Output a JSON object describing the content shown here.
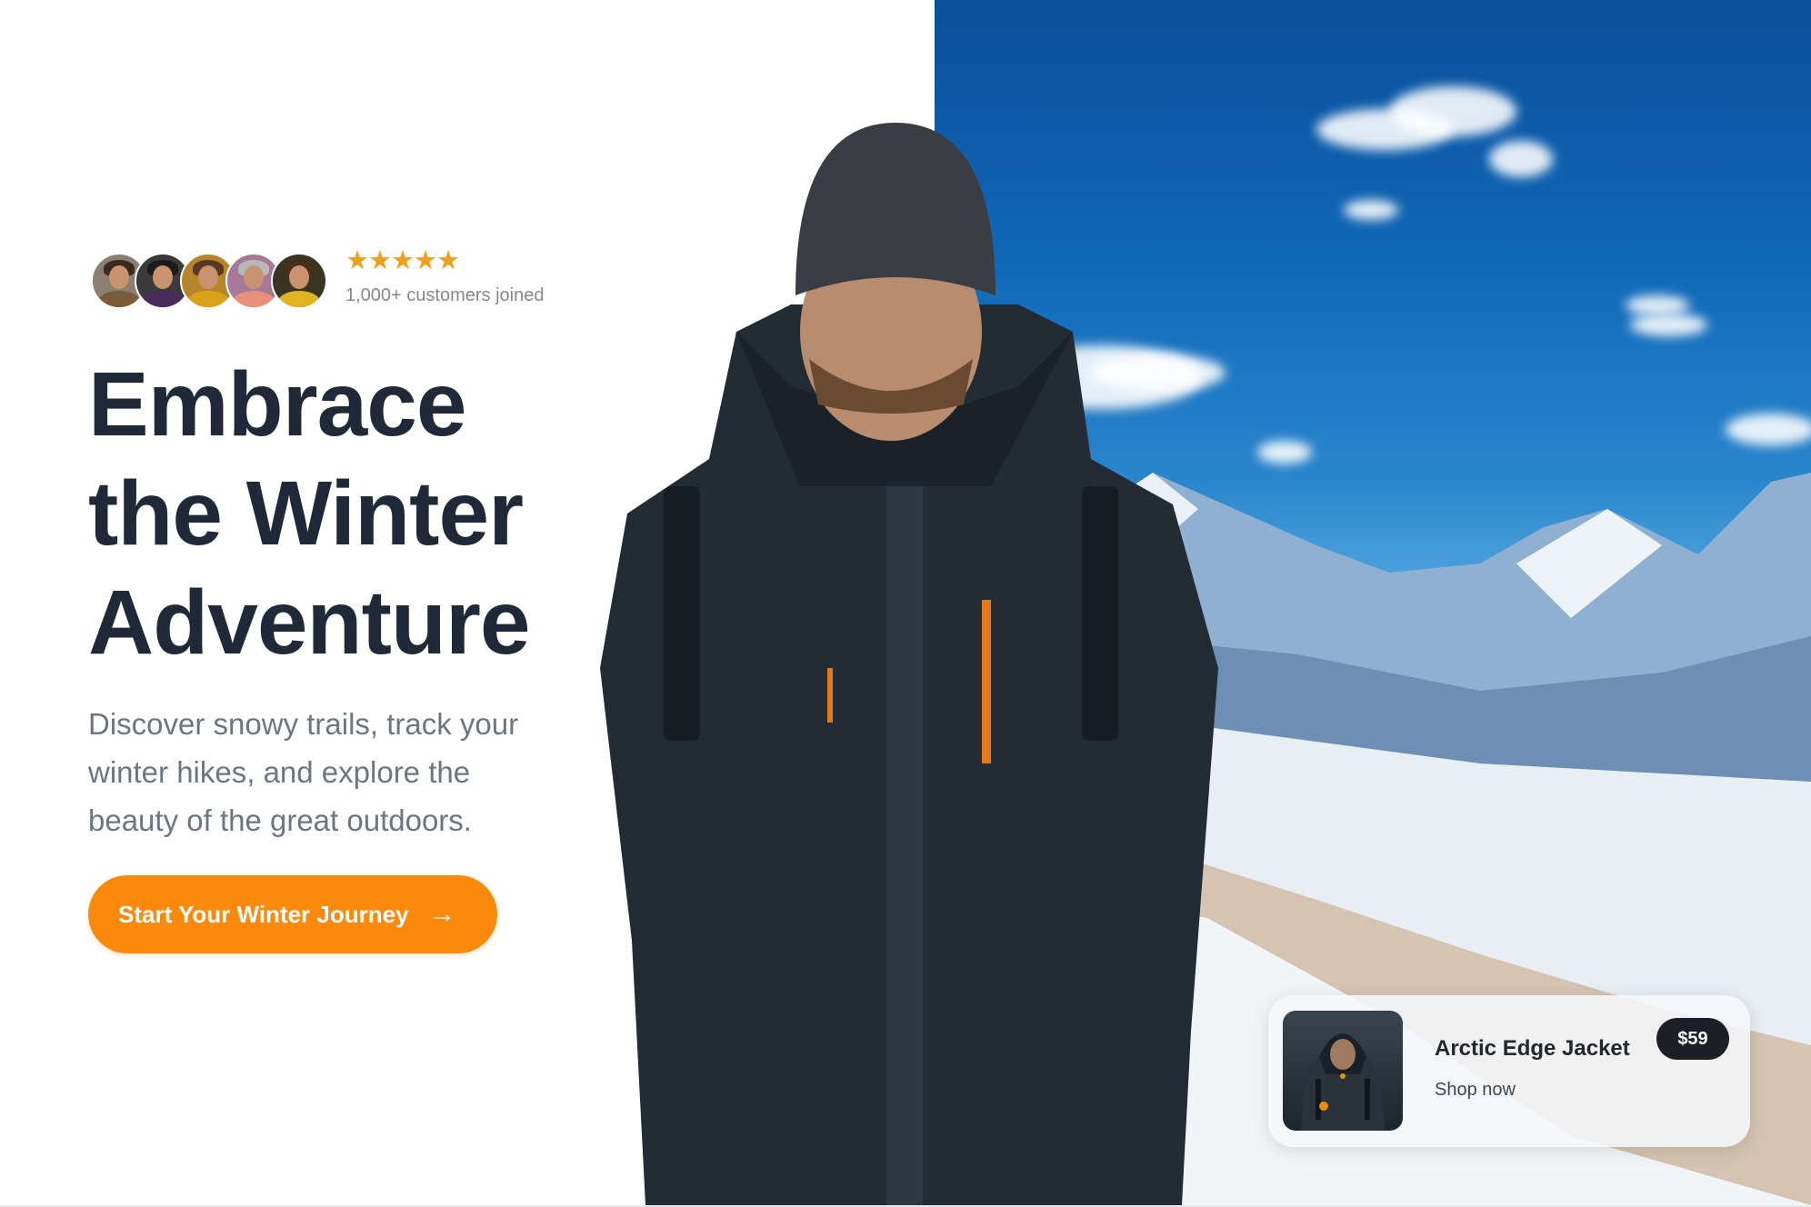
{
  "social_proof": {
    "avatars": [
      {
        "name": "customer-avatar-1",
        "hair": "#3a2a1e",
        "shirt": "#7a5a3a",
        "bg": "#8a7f70"
      },
      {
        "name": "customer-avatar-2",
        "hair": "#1e1a18",
        "shirt": "#4a2a5a",
        "bg": "#3a3a3a"
      },
      {
        "name": "customer-avatar-3",
        "hair": "#5a3a22",
        "shirt": "#d9a21a",
        "bg": "#b8862a"
      },
      {
        "name": "customer-avatar-4",
        "hair": "#b8b8b8",
        "shirt": "#e8907a",
        "bg": "#a87898"
      },
      {
        "name": "customer-avatar-5",
        "hair": "#4a2e1c",
        "shirt": "#e0b420",
        "bg": "#3a3522"
      }
    ],
    "rating_stars": "★★★★★",
    "rating_value": 5,
    "rating_max": 5,
    "customers_text": "1,000+ customers joined"
  },
  "hero": {
    "title_lines": [
      "Embrace",
      "the Winter",
      "Adventure"
    ],
    "description": "Discover snowy trails, track your winter hikes, and explore the beauty of the great outdoors.",
    "cta_label": "Start Your Winter Journey",
    "cta_icon": "arrow-right-icon",
    "cta_arrow_glyph": "→"
  },
  "product_card": {
    "name": "Arctic Edge Jacket",
    "link_label": "Shop now",
    "price": "$59"
  },
  "colors": {
    "accent": "#fb8a0c",
    "heading": "#1f2937",
    "body_text": "#6b7684",
    "star": "#f0a020",
    "price_badge": "#1c1f23"
  }
}
